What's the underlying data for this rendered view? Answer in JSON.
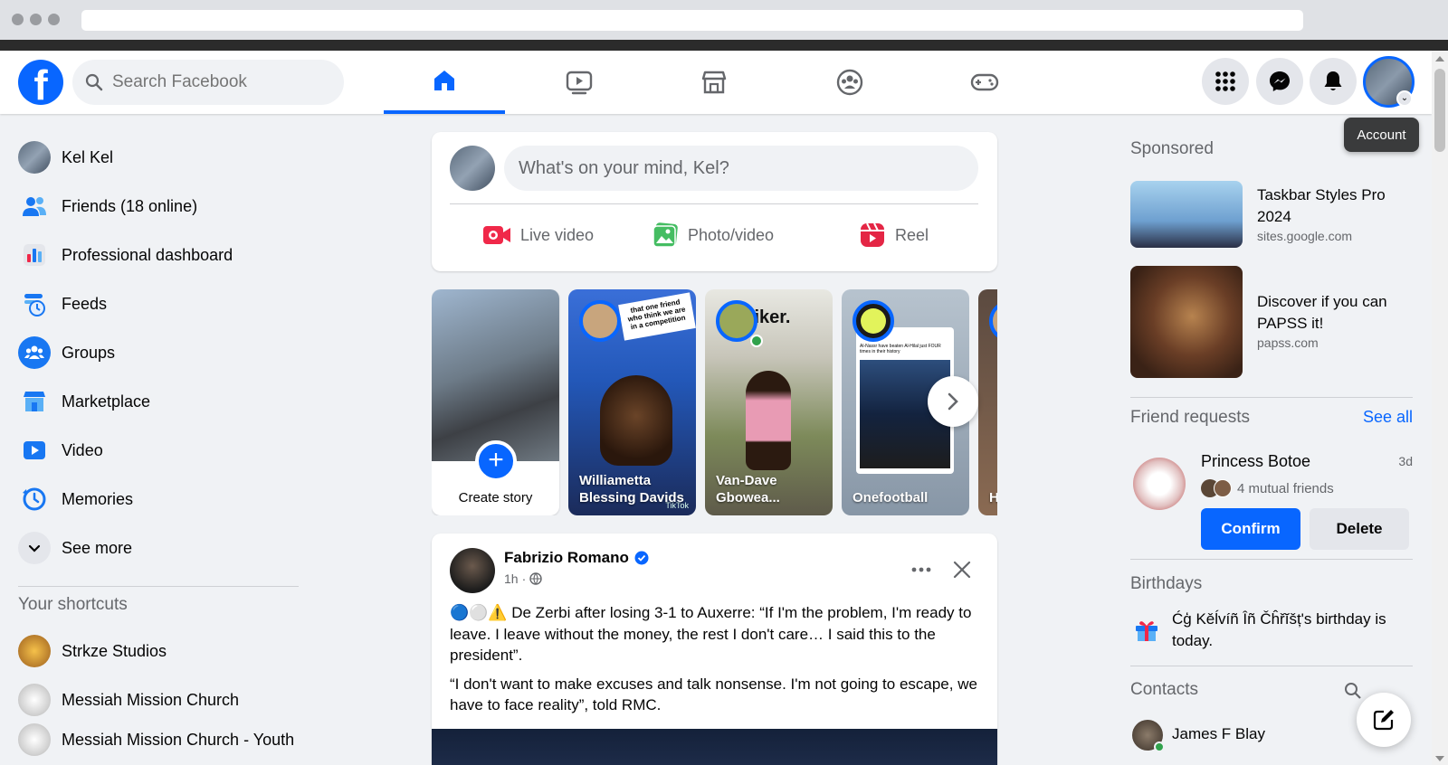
{
  "browser": {
    "url": ""
  },
  "header": {
    "logo": "f",
    "search_placeholder": "Search Facebook",
    "tooltip": "Account"
  },
  "sidebar": {
    "items": [
      {
        "label": "Kel Kel",
        "icon": "profile-avatar"
      },
      {
        "label": "Friends (18 online)",
        "icon": "friends-icon"
      },
      {
        "label": "Professional dashboard",
        "icon": "dashboard-icon"
      },
      {
        "label": "Feeds",
        "icon": "feeds-icon"
      },
      {
        "label": "Groups",
        "icon": "groups-icon"
      },
      {
        "label": "Marketplace",
        "icon": "marketplace-icon"
      },
      {
        "label": "Video",
        "icon": "video-icon"
      },
      {
        "label": "Memories",
        "icon": "memories-icon"
      },
      {
        "label": "See more",
        "icon": "chevron-down-icon"
      }
    ],
    "shortcuts_title": "Your shortcuts",
    "shortcuts": [
      {
        "label": "Strkze Studios"
      },
      {
        "label": "Messiah Mission Church"
      },
      {
        "label": "Messiah Mission Church - Youth"
      }
    ]
  },
  "composer": {
    "placeholder": "What's on your mind, Kel?",
    "actions": [
      {
        "label": "Live video",
        "color": "#f02849"
      },
      {
        "label": "Photo/video",
        "color": "#45bd62"
      },
      {
        "label": "Reel",
        "color": "#e42645"
      }
    ]
  },
  "stories": [
    {
      "label": "Create story"
    },
    {
      "label": "Williametta Blessing Davids"
    },
    {
      "label": "Van-Dave Gbowea..."
    },
    {
      "label": "Onefootball"
    },
    {
      "label": "H"
    }
  ],
  "story_overlay_texts": {
    "williametta_caption": "that one friend who think we are in a competition",
    "vandave_caption": "triker.",
    "onefootball_caption": "Al-Nassr have beaten Al-Hilal just FOUR times in their history",
    "tiktok": "TikTok"
  },
  "post": {
    "author": "Fabrizio Romano",
    "time": "1h",
    "paragraphs": [
      "🔵⚪️⚠️ De Zerbi after losing 3-1 to Auxerre: “If I'm the problem, I'm ready to leave. I leave without the money, the rest I don't care… I said this to the president”.",
      "“I don't want to make excuses and talk nonsense. I'm not going to escape, we have to face reality”, told RMC."
    ]
  },
  "sponsored": {
    "title": "Sponsored",
    "ads": [
      {
        "title": "Taskbar Styles Pro 2024",
        "site": "sites.google.com"
      },
      {
        "title": "Discover if you can PAPSS it!",
        "site": "papss.com"
      }
    ]
  },
  "friend_requests": {
    "title": "Friend requests",
    "see_all": "See all",
    "name": "Princess Botoe",
    "age": "3d",
    "mutual": "4 mutual friends",
    "confirm": "Confirm",
    "delete": "Delete"
  },
  "birthdays": {
    "title": "Birthdays",
    "text": "Ćģ Kěĺvíñ Îñ Čĥřĭšț's birthday is today."
  },
  "contacts": {
    "title": "Contacts",
    "items": [
      {
        "name": "James F Blay"
      }
    ]
  },
  "colors": {
    "brand": "#0866ff",
    "background": "#f0f2f5",
    "secondary_text": "#65676b"
  }
}
